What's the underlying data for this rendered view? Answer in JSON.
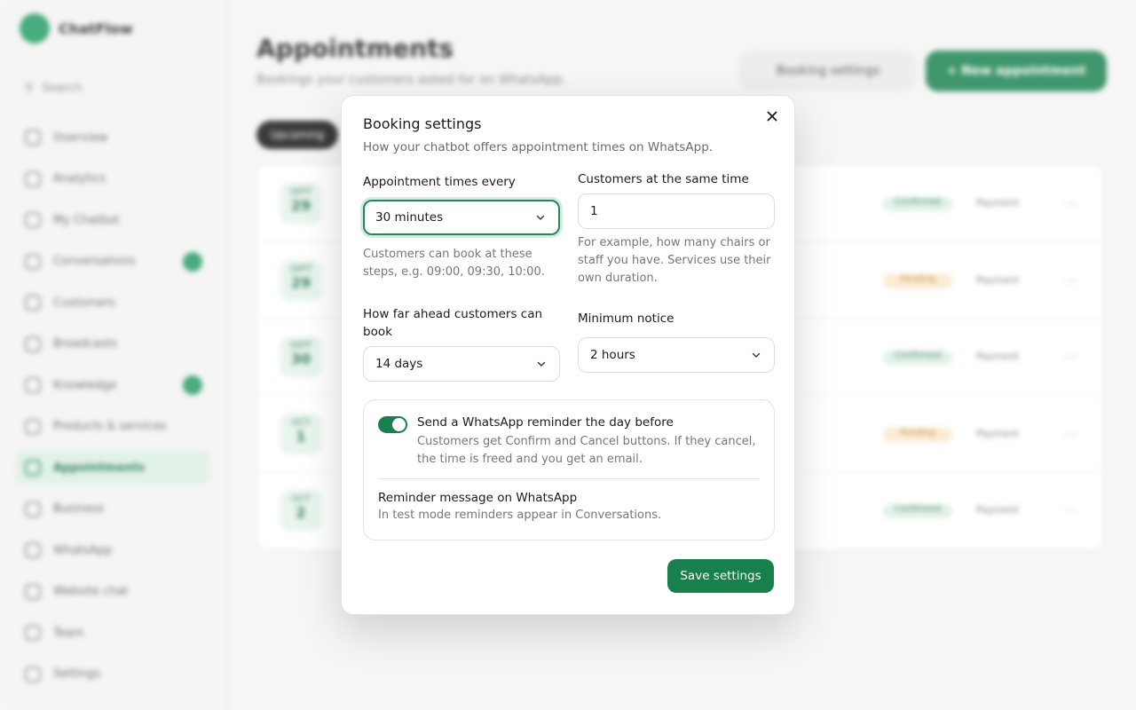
{
  "app": {
    "brand": "ChatFlow",
    "search_label": "Search",
    "sidebar_items": [
      {
        "label": "Overview"
      },
      {
        "label": "Analytics"
      },
      {
        "label": "My Chatbot"
      },
      {
        "label": "Conversations",
        "badge": true
      },
      {
        "label": "Customers"
      },
      {
        "label": "Broadcasts"
      },
      {
        "label": "Knowledge",
        "badge": true
      },
      {
        "label": "Products & services"
      },
      {
        "label": "Appointments",
        "active": true
      },
      {
        "label": "Business"
      },
      {
        "label": "WhatsApp"
      },
      {
        "label": "Website chat"
      },
      {
        "label": "Team"
      },
      {
        "label": "Settings"
      }
    ],
    "page_title": "Appointments",
    "page_subtitle": "Bookings your customers asked for on WhatsApp.",
    "booking_settings_button": "Booking settings",
    "new_appointment_button": "+ New appointment",
    "filter_chip": "Upcoming",
    "rows": [
      {
        "month": "SEPT",
        "day": "29",
        "status": "Confirmed",
        "status_kind": "confirmed",
        "channel": "Payment"
      },
      {
        "month": "SEPT",
        "day": "29",
        "status": "Pending",
        "status_kind": "pending",
        "channel": "Payment"
      },
      {
        "month": "SEPT",
        "day": "30",
        "status": "Confirmed",
        "status_kind": "confirmed",
        "channel": "Payment"
      },
      {
        "month": "OCT",
        "day": "1",
        "status": "Pending",
        "status_kind": "pending",
        "channel": "Payment"
      },
      {
        "month": "OCT",
        "day": "2",
        "status": "Confirmed",
        "status_kind": "confirmed",
        "channel": "Payment"
      }
    ]
  },
  "modal": {
    "title": "Booking settings",
    "subtitle": "How your chatbot offers appointment times on WhatsApp.",
    "interval": {
      "label": "Appointment times every",
      "value": "30 minutes",
      "help": "Customers can book at these steps, e.g. 09:00, 09:30, 10:00."
    },
    "capacity": {
      "label": "Customers at the same time",
      "value": "1",
      "help": "For example, how many chairs or staff you have. Services use their own duration."
    },
    "horizon": {
      "label": "How far ahead customers can book",
      "value": "14 days"
    },
    "notice": {
      "label": "Minimum notice",
      "value": "2 hours"
    },
    "reminder": {
      "enabled": true,
      "title": "Send a WhatsApp reminder the day before",
      "description": "Customers get Confirm and Cancel buttons. If they cancel, the time is freed and you get an email.",
      "message_title": "Reminder message on WhatsApp",
      "message_description": "In test mode reminders appear in Conversations."
    },
    "save_label": "Save settings"
  },
  "colors": {
    "accent": "#17804c",
    "focus_ring": "#d4ecdf",
    "pending": "#fbe7c9"
  }
}
